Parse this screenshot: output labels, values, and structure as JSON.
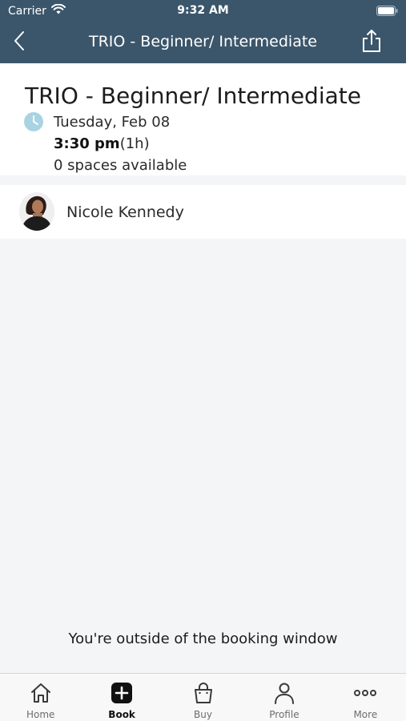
{
  "status_bar": {
    "carrier": "Carrier",
    "time": "9:32 AM",
    "icons": [
      "wifi-icon",
      "battery-icon"
    ]
  },
  "nav": {
    "title": "TRIO - Beginner/ Intermediate",
    "back_icon": "chevron-left-icon",
    "share_icon": "share-icon"
  },
  "class_info": {
    "title": "TRIO - Beginner/ Intermediate",
    "date": "Tuesday, Feb 08",
    "time": "3:30 pm",
    "duration": "(1h)",
    "spaces": "0 spaces available"
  },
  "instructor": {
    "name": "Nicole Kennedy"
  },
  "booking_message": "You're outside of the booking window",
  "tabs": [
    {
      "label": "Home",
      "icon": "home-icon",
      "active": false
    },
    {
      "label": "Book",
      "icon": "plus-square-icon",
      "active": true
    },
    {
      "label": "Buy",
      "icon": "shopping-bag-icon",
      "active": false
    },
    {
      "label": "Profile",
      "icon": "person-icon",
      "active": false
    },
    {
      "label": "More",
      "icon": "more-dots-icon",
      "active": false
    }
  ],
  "colors": {
    "header_bg": "#3b566b",
    "page_bg": "#f4f5f7",
    "clock_icon": "#a9d3e3",
    "tab_bar_bg": "#f8f8f8"
  }
}
